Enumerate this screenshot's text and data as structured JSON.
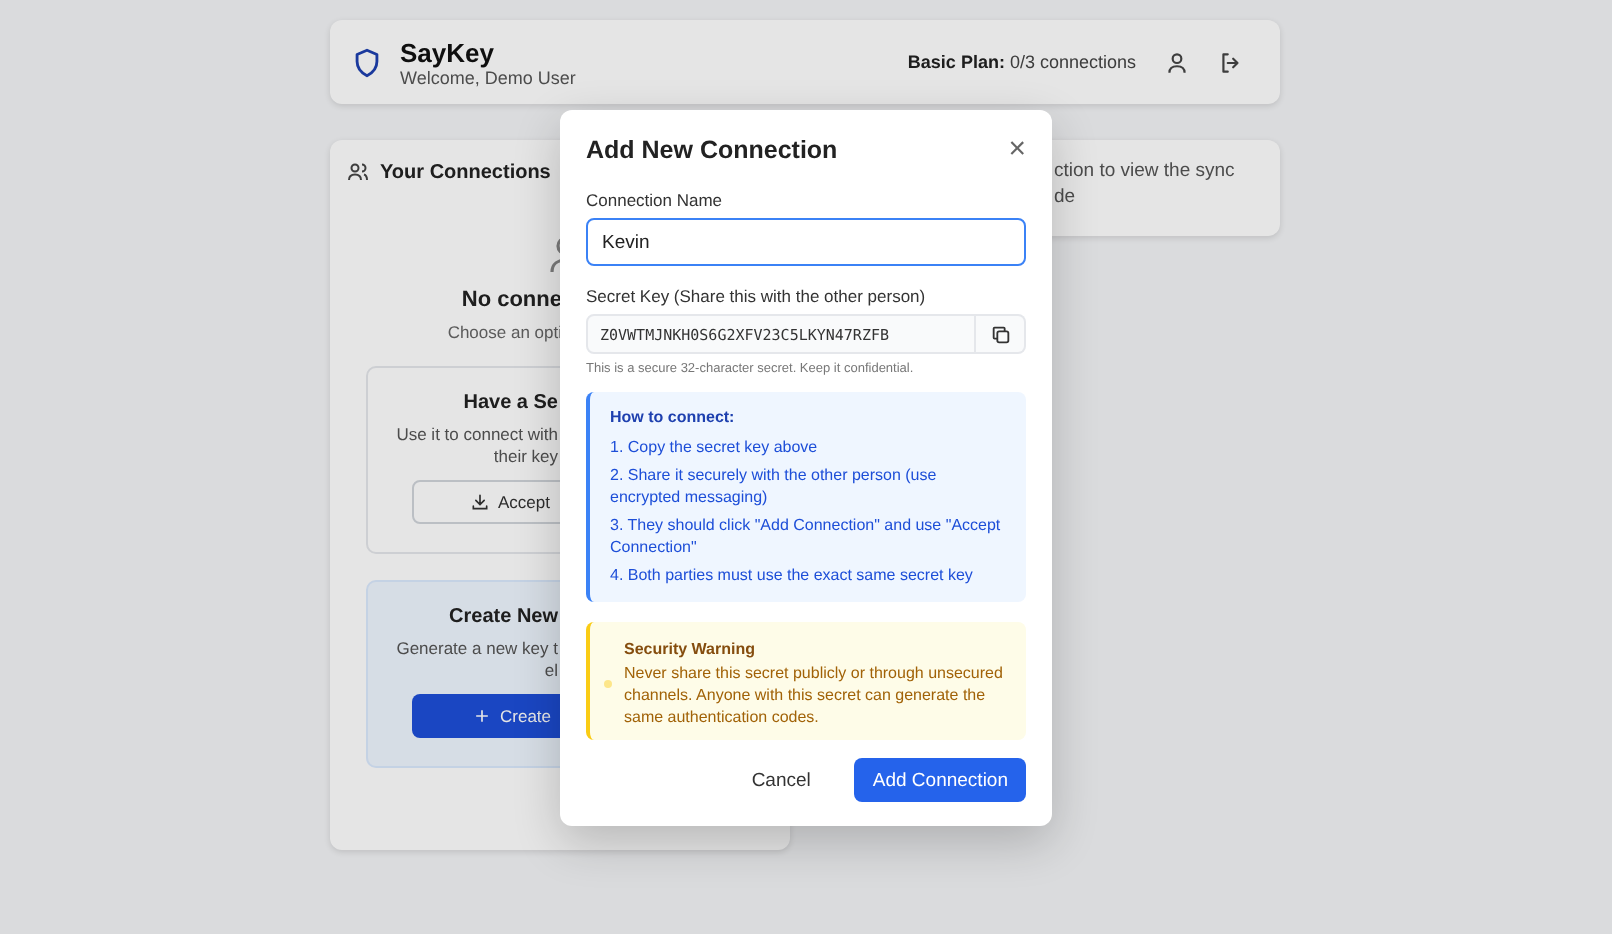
{
  "header": {
    "app_name": "SayKey",
    "welcome": "Welcome, Demo User",
    "plan_label": "Basic Plan:",
    "plan_usage": "0/3 connections"
  },
  "connections_panel": {
    "title": "Your Connections",
    "empty_title": "No conne",
    "empty_hint": "Choose an opti",
    "options": [
      {
        "kind": "accept",
        "title": "Have a Se",
        "lines": [
          "Use it to connect with",
          "their key"
        ],
        "button": "Accept"
      },
      {
        "kind": "create",
        "title": "Create New",
        "lines": [
          "Generate a new key t",
          "el"
        ],
        "button": "Create"
      }
    ]
  },
  "sync_panel": {
    "lines": [
      "ction to view the sync",
      "de"
    ]
  },
  "dialog": {
    "title": "Add New Connection",
    "close": "×",
    "name_label": "Connection Name",
    "name_value": "Kevin",
    "key_label": "Secret Key (Share this with the other person)",
    "key_value": "Z0VWTMJNKH0S6G2XFV23C5LKYN47RZFB",
    "key_hint": "This is a secure 32-character secret. Keep it confidential.",
    "info": {
      "title": "How to connect:",
      "steps": [
        "1. Copy the secret key above",
        "2. Share it securely with the other person (use encrypted messaging)",
        "3. They should click \"Add Connection\" and use \"Accept Connection\"",
        "4. Both parties must use the exact same secret key"
      ]
    },
    "warning": {
      "title": "Security Warning",
      "text": "Never share this secret publicly or through unsecured channels. Anyone with this secret can generate the same authentication codes."
    },
    "buttons": [
      {
        "label": "Cancel",
        "kind": "secondary"
      },
      {
        "label": "Add Connection",
        "kind": "primary"
      }
    ]
  }
}
